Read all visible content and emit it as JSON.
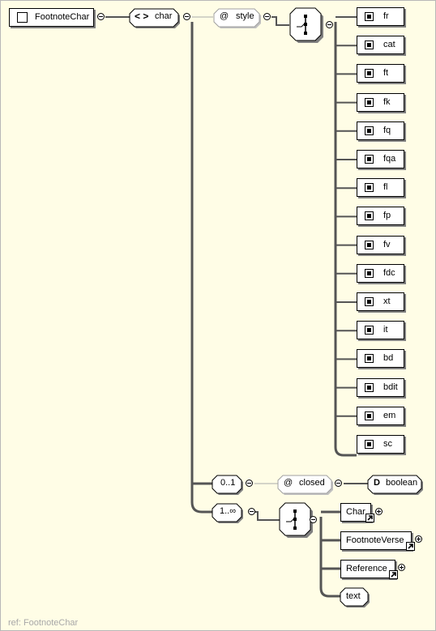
{
  "root": {
    "name": "FootnoteChar",
    "icon": "element-icon"
  },
  "char_group": {
    "name": "char",
    "icon": "complex-type-icon"
  },
  "style_attr": {
    "prefix": "@",
    "name": "style"
  },
  "style_choice": {
    "icon": "choice-icon"
  },
  "style_values": [
    "fr",
    "cat",
    "ft",
    "fk",
    "fq",
    "fqa",
    "fl",
    "fp",
    "fv",
    "fdc",
    "xt",
    "it",
    "bd",
    "bdit",
    "em",
    "sc"
  ],
  "closed_branch": {
    "cardinality": "0..1",
    "attr_prefix": "@",
    "attr_name": "closed",
    "type_prefix": "D",
    "type_name": "boolean"
  },
  "content_branch": {
    "cardinality": "1..∞",
    "items": [
      {
        "name": "Char",
        "kind": "ref"
      },
      {
        "name": "FootnoteVerse",
        "kind": "ref"
      },
      {
        "name": "Reference",
        "kind": "ref"
      },
      {
        "name": "text",
        "kind": "text"
      }
    ]
  },
  "caption": "ref: FootnoteChar"
}
